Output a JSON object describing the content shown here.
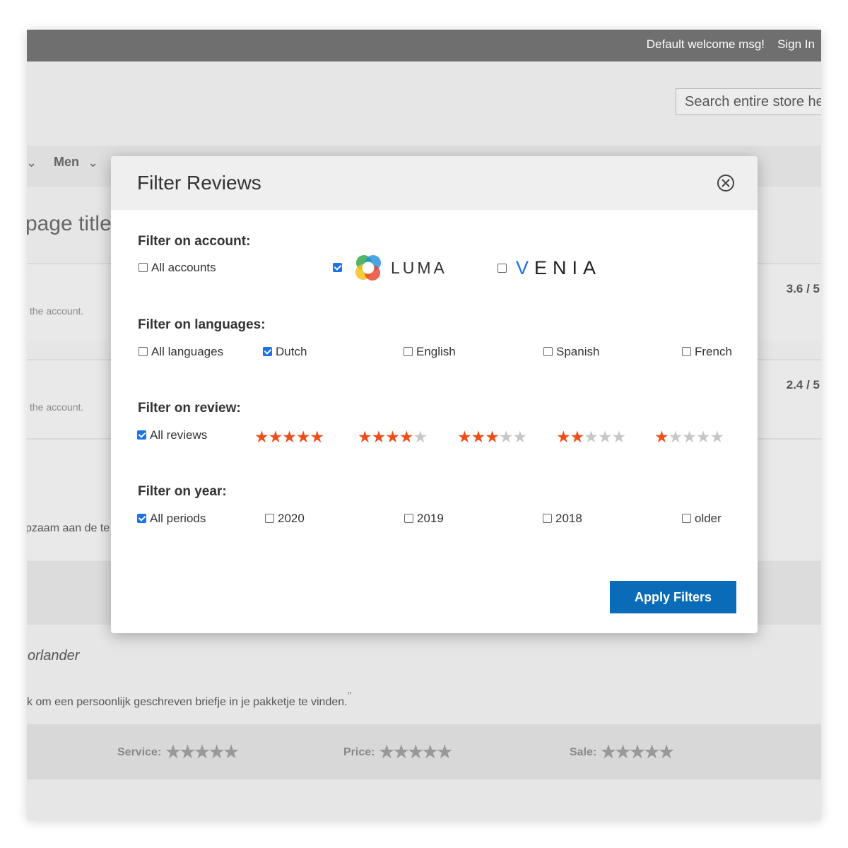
{
  "topbar": {
    "welcome": "Default welcome msg!",
    "signin": "Sign In"
  },
  "search": {
    "text": "Search entire store he"
  },
  "nav": {
    "men": "Men"
  },
  "page": {
    "title": "page title"
  },
  "reviews": [
    {
      "account": "the account.",
      "score": "3.6 / 5"
    },
    {
      "account": "the account.",
      "score": "2.4 / 5"
    }
  ],
  "background_text": {
    "dutch_line": "pzaam aan de te",
    "author": "orlander",
    "quote": "k om een persoonlijk geschreven briefje in je pakketje te vinden.",
    "quote_mark": "”",
    "ratings": [
      {
        "label": "Service:",
        "stars": "★★★★★"
      },
      {
        "label": "Price:",
        "stars": "★★★★★"
      },
      {
        "label": "Sale:",
        "stars": "★★★★★"
      }
    ]
  },
  "modal": {
    "title": "Filter Reviews",
    "account": {
      "label": "Filter on account:",
      "all": {
        "label": "All accounts",
        "checked": false
      },
      "luma": {
        "label": "LUMA",
        "checked": true
      },
      "venia": {
        "label_v": "V",
        "label_rest": "ENIA",
        "checked": false
      }
    },
    "languages": {
      "label": "Filter on languages:",
      "options": [
        {
          "label": "All languages",
          "checked": false
        },
        {
          "label": "Dutch",
          "checked": true
        },
        {
          "label": "English",
          "checked": false
        },
        {
          "label": "Spanish",
          "checked": false
        },
        {
          "label": "French",
          "checked": false
        }
      ]
    },
    "review": {
      "label": "Filter on review:",
      "all": {
        "label": "All reviews",
        "checked": true
      },
      "star_options": [
        {
          "on": "★★★★★",
          "off": ""
        },
        {
          "on": "★★★★",
          "off": "★"
        },
        {
          "on": "★★★",
          "off": "★★"
        },
        {
          "on": "★★",
          "off": "★★★"
        },
        {
          "on": "★",
          "off": "★★★★"
        }
      ]
    },
    "year": {
      "label": "Filter on year:",
      "options": [
        {
          "label": "All periods",
          "checked": true
        },
        {
          "label": "2020",
          "checked": false
        },
        {
          "label": "2019",
          "checked": false
        },
        {
          "label": "2018",
          "checked": false
        },
        {
          "label": "older",
          "checked": false
        }
      ]
    },
    "apply_label": "Apply Filters"
  },
  "colors": {
    "accent": "#1a73e8",
    "star": "#ee4d1a",
    "button": "#0a6bb8",
    "topbar": "#6f6f6f"
  }
}
